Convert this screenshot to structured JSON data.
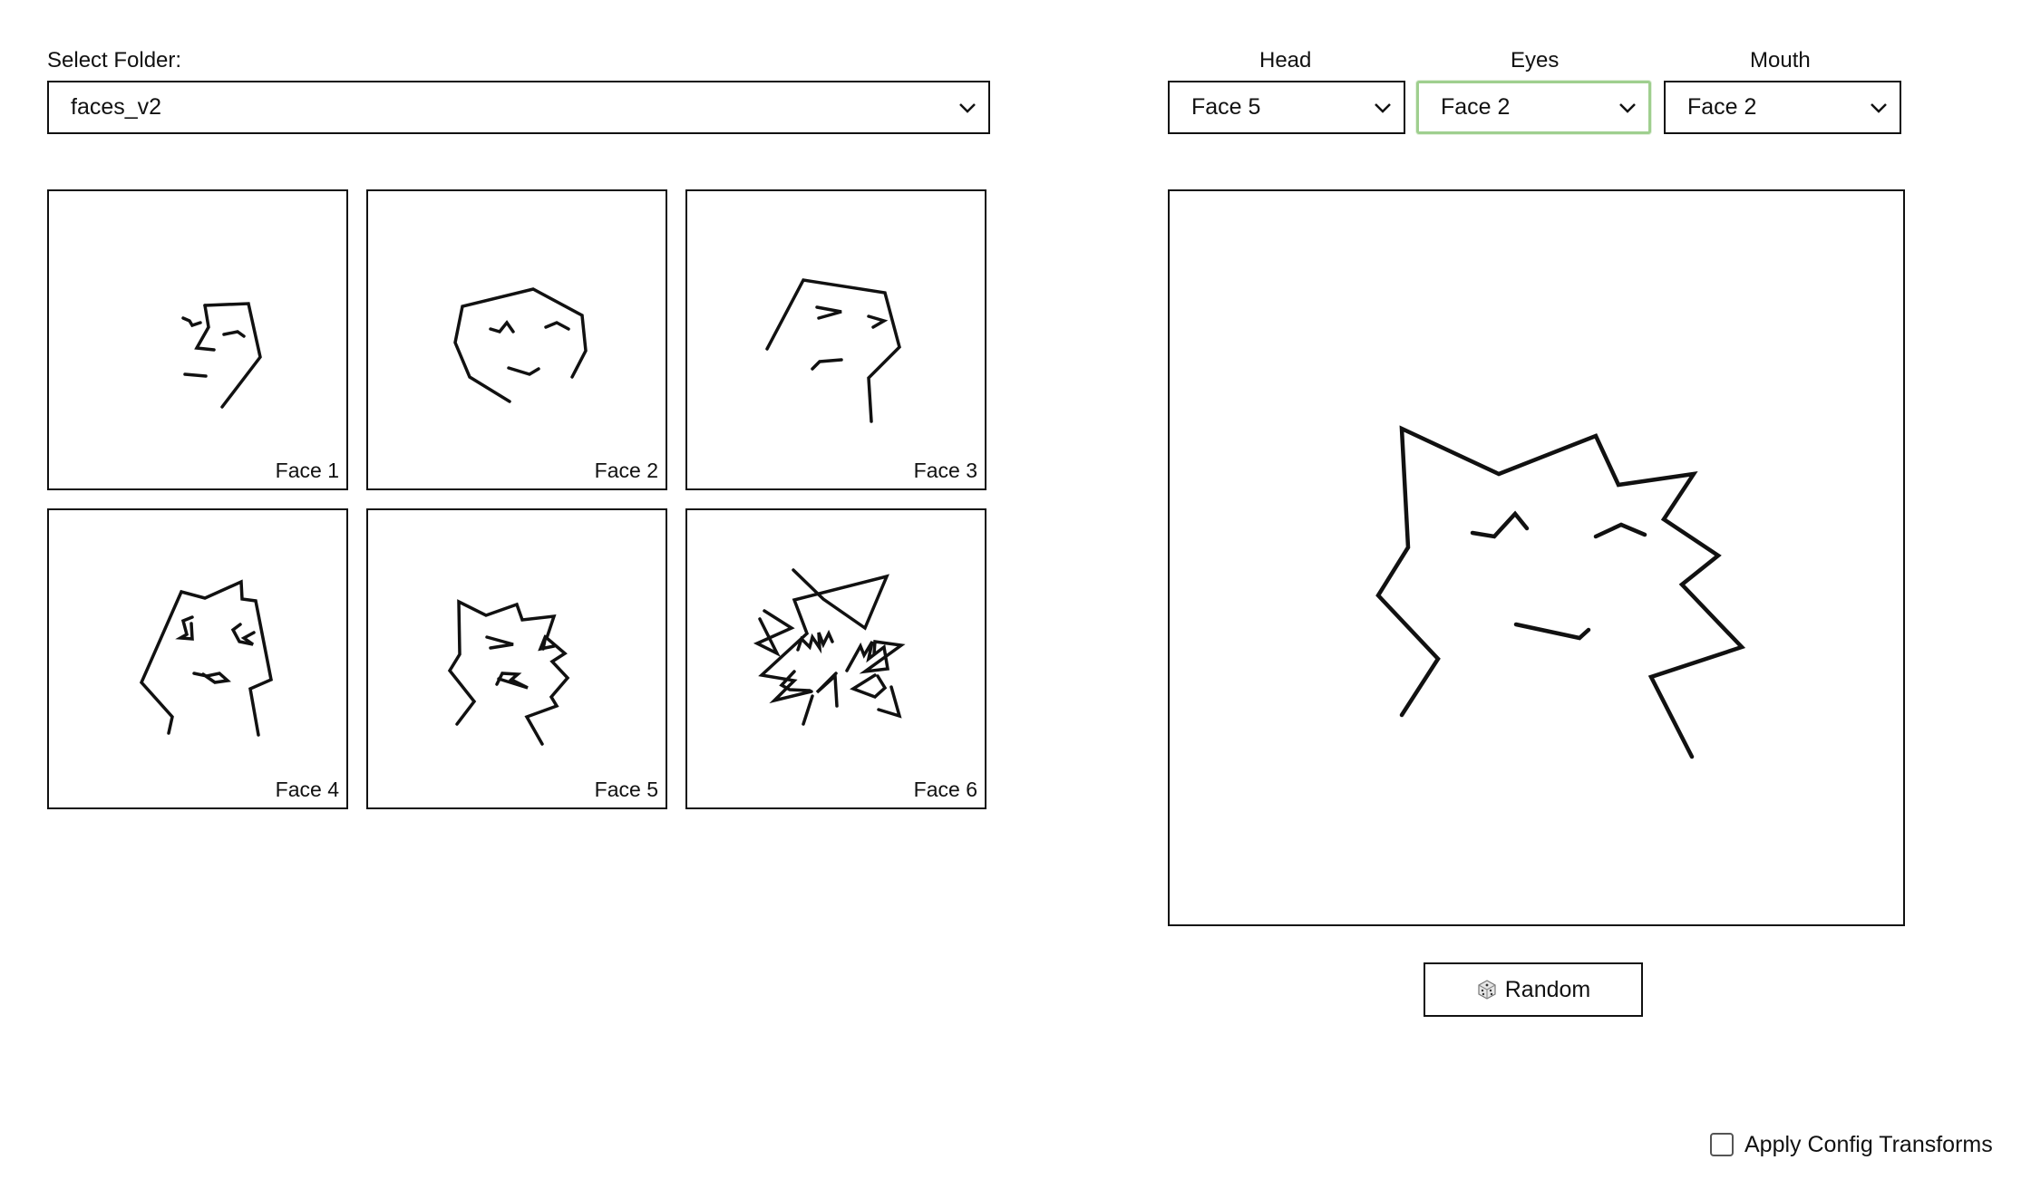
{
  "folder": {
    "label": "Select Folder:",
    "value": "faces_v2"
  },
  "thumbnails": [
    {
      "label": "Face 1"
    },
    {
      "label": "Face 2"
    },
    {
      "label": "Face 3"
    },
    {
      "label": "Face 4"
    },
    {
      "label": "Face 5"
    },
    {
      "label": "Face 6"
    }
  ],
  "parts": {
    "head": {
      "label": "Head",
      "value": "Face 5"
    },
    "eyes": {
      "label": "Eyes",
      "value": "Face 2"
    },
    "mouth": {
      "label": "Mouth",
      "value": "Face 2"
    }
  },
  "random_button": {
    "icon": "dice-icon",
    "label": "Random"
  },
  "transforms": {
    "label": "Apply Config Transforms",
    "checked": false
  },
  "colors": {
    "focus_border": "#9fcf8f",
    "stroke": "#111111"
  }
}
